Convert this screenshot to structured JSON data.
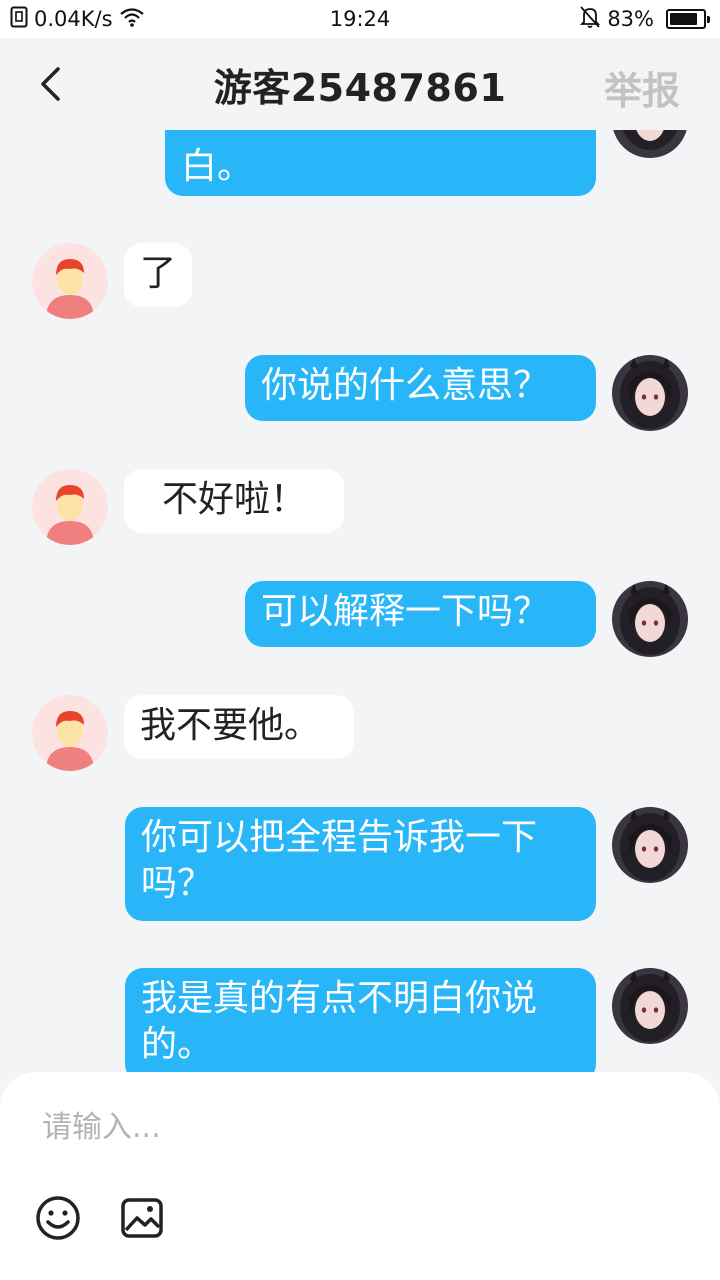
{
  "status_bar": {
    "speed": "0.04K/s",
    "time": "19:24",
    "battery_percent": "83%",
    "battery_level": 0.83
  },
  "header": {
    "title": "游客25487861",
    "report_label": "举报"
  },
  "messages": [
    {
      "direction": "out",
      "text": "白。"
    },
    {
      "direction": "in",
      "text": "了"
    },
    {
      "direction": "out",
      "text": "你说的什么意思？"
    },
    {
      "direction": "in",
      "text": "不好啦！"
    },
    {
      "direction": "out",
      "text": "可以解释一下吗？"
    },
    {
      "direction": "in",
      "text": "我不要他。"
    },
    {
      "direction": "out",
      "text": "你可以把全程告诉我一下吗？"
    },
    {
      "direction": "out",
      "text": "我是真的有点不明白你说的。"
    }
  ],
  "input": {
    "placeholder": "请输入..."
  },
  "colors": {
    "outgoing_bubble": "#28b6f8",
    "incoming_bubble": "#ffffff",
    "background": "#f3f4f6",
    "report_text": "#c2c2c2"
  }
}
